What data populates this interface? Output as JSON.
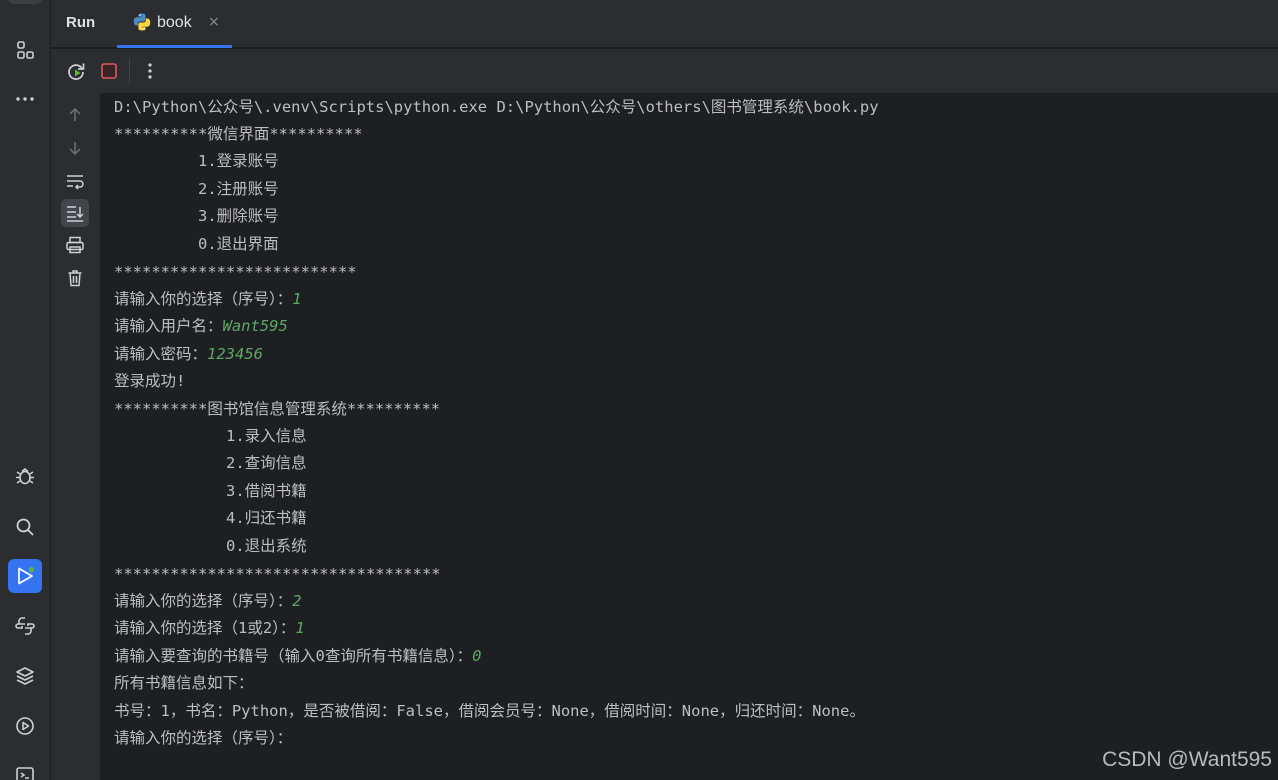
{
  "header": {
    "run_title": "Run",
    "tab_label": "book",
    "tab_close": "×"
  },
  "console": {
    "lines": [
      {
        "text": "D:\\Python\\公众号\\.venv\\Scripts\\python.exe D:\\Python\\公众号\\others\\图书管理系统\\book.py",
        "input": ""
      },
      {
        "text": "**********微信界面**********",
        "input": ""
      },
      {
        "text": "         1.登录账号",
        "input": ""
      },
      {
        "text": "         2.注册账号",
        "input": ""
      },
      {
        "text": "         3.删除账号",
        "input": ""
      },
      {
        "text": "         0.退出界面",
        "input": ""
      },
      {
        "text": "**************************",
        "input": ""
      },
      {
        "text": "请输入你的选择（序号）：",
        "input": "1"
      },
      {
        "text": "请输入用户名：",
        "input": "Want595"
      },
      {
        "text": "请输入密码：",
        "input": "123456"
      },
      {
        "text": "登录成功!",
        "input": ""
      },
      {
        "text": "**********图书馆信息管理系统**********",
        "input": ""
      },
      {
        "text": "            1.录入信息",
        "input": ""
      },
      {
        "text": "            2.查询信息",
        "input": ""
      },
      {
        "text": "            3.借阅书籍",
        "input": ""
      },
      {
        "text": "            4.归还书籍",
        "input": ""
      },
      {
        "text": "            0.退出系统",
        "input": ""
      },
      {
        "text": "***********************************",
        "input": ""
      },
      {
        "text": "请输入你的选择（序号）：",
        "input": "2"
      },
      {
        "text": "请输入你的选择（1或2）：",
        "input": "1"
      },
      {
        "text": "请输入要查询的书籍号（输入0查询所有书籍信息）：",
        "input": "0"
      },
      {
        "text": "所有书籍信息如下：",
        "input": ""
      },
      {
        "text": "书号：1，书名：Python，是否被借阅：False，借阅会员号：None，借阅时间：None，归还时间：None。",
        "input": ""
      },
      {
        "text": "请输入你的选择（序号）：",
        "input": ""
      }
    ]
  },
  "watermark": "CSDN @Want595",
  "icons": {
    "activity": [
      "structure-icon",
      "more-icon",
      "debug-icon",
      "search-icon",
      "run-icon",
      "python-console-icon",
      "layers-icon",
      "services-icon",
      "terminal-icon"
    ],
    "toolbar": [
      "rerun-icon",
      "stop-icon",
      "more-vertical-icon"
    ],
    "console_side": [
      "scroll-up-icon",
      "scroll-down-icon",
      "soft-wrap-icon",
      "scroll-to-end-icon",
      "print-icon",
      "clear-icon"
    ]
  },
  "colors": {
    "accent": "#3574f0",
    "stop": "#db5c5c",
    "user_input": "#5fa565",
    "console_text": "#bcbec4"
  }
}
